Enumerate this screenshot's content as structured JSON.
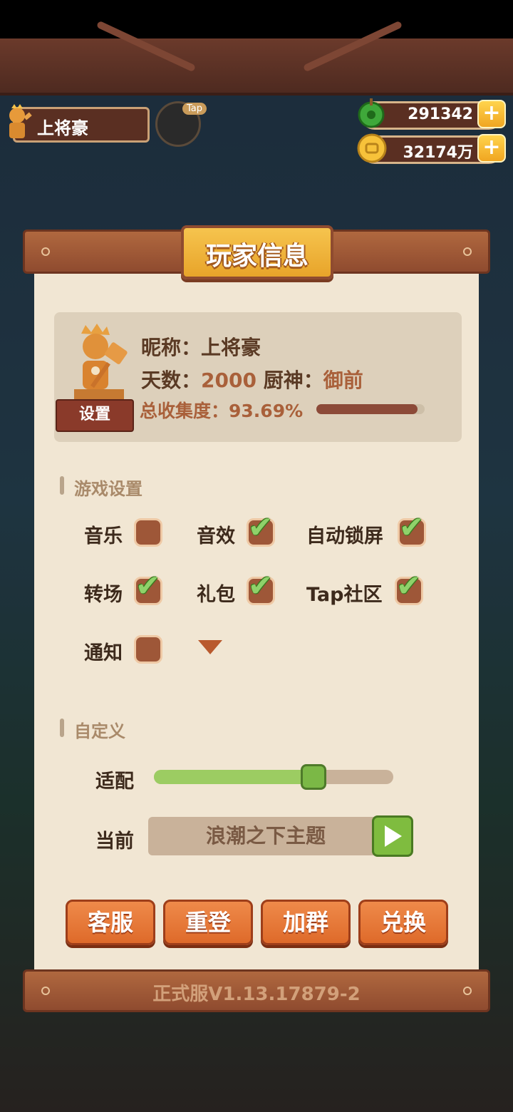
{
  "player": {
    "name": "上将豪",
    "tap_badge": "Tap"
  },
  "currency": {
    "jade": {
      "icon": "jade-icon",
      "value": "291342"
    },
    "coin": {
      "icon": "coin-icon",
      "value": "32174万"
    }
  },
  "modal": {
    "title": "玩家信息",
    "info": {
      "nickname_label": "昵称：",
      "nickname": "上将豪",
      "days_label": "天数：",
      "days": "2000",
      "chef_label": "厨神：",
      "chef": "御前",
      "collection_label": "总收集度：",
      "collection": "93.69%",
      "collection_fraction": 0.9369,
      "settings_button": "设置"
    },
    "game_settings": {
      "title": "游戏设置",
      "options": [
        {
          "label": "音乐",
          "checked": false
        },
        {
          "label": "音效",
          "checked": true
        },
        {
          "label": "自动锁屏",
          "checked": true
        },
        {
          "label": "转场",
          "checked": true
        },
        {
          "label": "礼包",
          "checked": true
        },
        {
          "label": "Tap社区",
          "checked": true
        },
        {
          "label": "通知",
          "checked": false
        }
      ]
    },
    "custom": {
      "title": "自定义",
      "adapt_label": "适配",
      "adapt_fraction": 0.64,
      "current_label": "当前",
      "current_theme": "浪潮之下主题"
    },
    "buttons": [
      "客服",
      "重登",
      "加群",
      "兑换"
    ],
    "version": "正式服V1.13.17879-2"
  },
  "colors": {
    "panel": "#f1e6d3",
    "accent_orange": "#de6a2a",
    "check_green": "#8fd26a",
    "title_gold": "#f6c44e"
  }
}
